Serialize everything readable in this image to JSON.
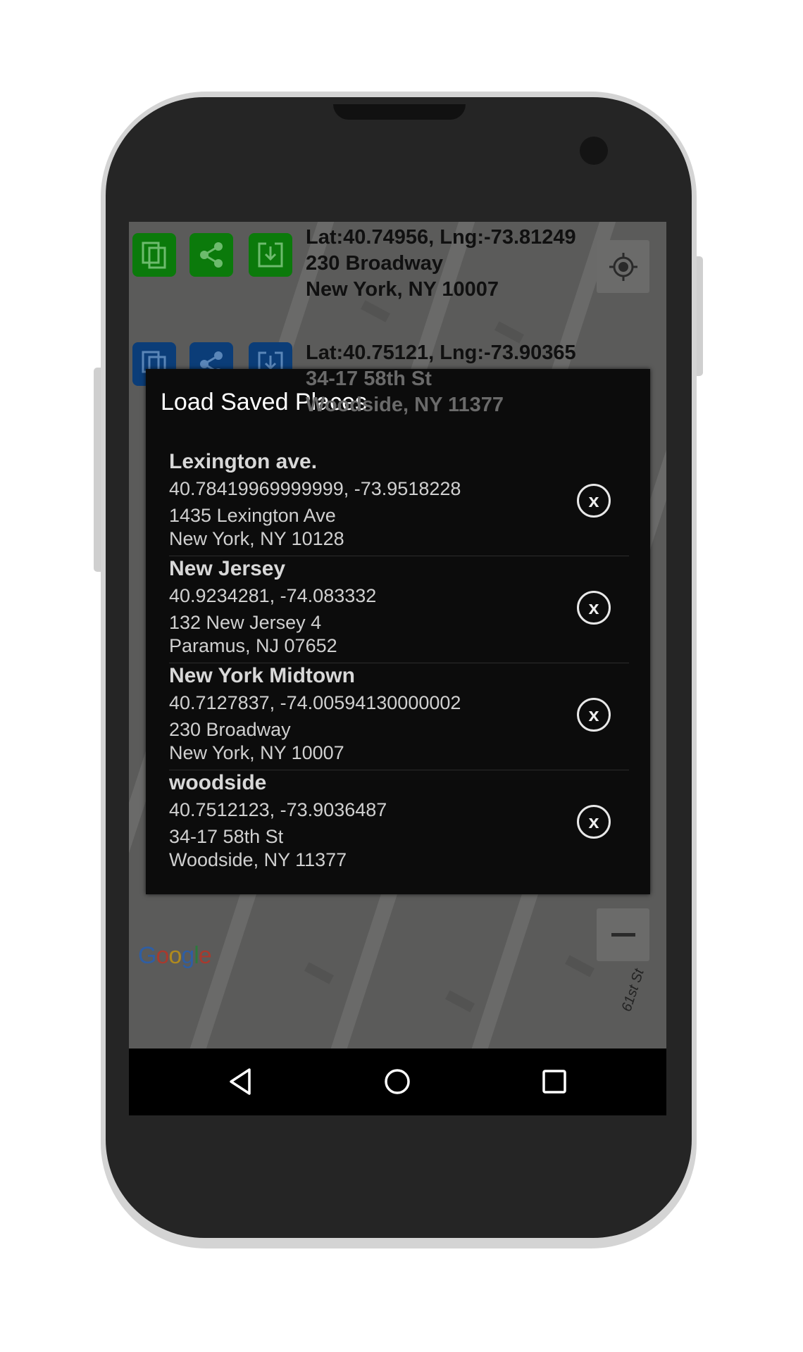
{
  "toolbar": {
    "primary": {
      "coords": "Lat:40.74956, Lng:-73.81249",
      "address_line1": "230 Broadway",
      "address_line2": "New York, NY 10007",
      "color": "#0b7a0b"
    },
    "secondary": {
      "coords": "Lat:40.75121, Lng:-73.90365",
      "address_line1": "34-17 58th St",
      "address_line2": "Woodside, NY 11377",
      "color": "#0b3d78"
    },
    "icons": [
      "copy-icon",
      "share-icon",
      "save-icon"
    ]
  },
  "map": {
    "attribution": "Google",
    "street_label": "61st St",
    "zoom_in": "+",
    "zoom_out": "−"
  },
  "dialog": {
    "title": "Load Saved Places",
    "items": [
      {
        "name": "Lexington ave.",
        "coords": "40.78419969999999, -73.9518228",
        "address_line1": "1435 Lexington Ave",
        "address_line2": "New York, NY 10128"
      },
      {
        "name": "New Jersey",
        "coords": "40.9234281, -74.083332",
        "address_line1": "132 New Jersey 4",
        "address_line2": "Paramus, NJ 07652"
      },
      {
        "name": "New York Midtown",
        "coords": "40.7127837, -74.00594130000002",
        "address_line1": "230 Broadway",
        "address_line2": "New York, NY 10007"
      },
      {
        "name": "woodside",
        "coords": "40.7512123, -73.9036487",
        "address_line1": "34-17 58th St",
        "address_line2": "Woodside, NY 11377"
      }
    ],
    "delete_icon": "x"
  },
  "navbar": {
    "icons": [
      "back-icon",
      "home-icon",
      "recents-icon"
    ]
  }
}
